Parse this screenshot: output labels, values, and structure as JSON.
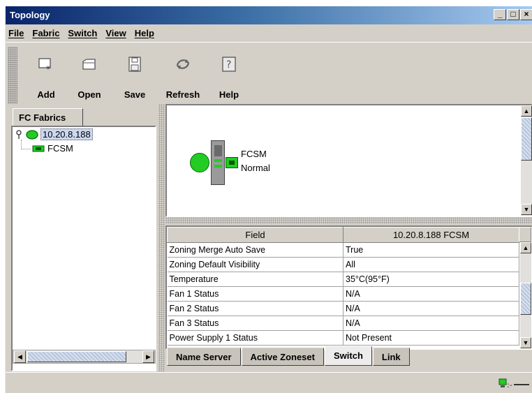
{
  "window": {
    "title": "Topology",
    "minimize": "_",
    "maximize": "□",
    "close": "×"
  },
  "menu": [
    "File",
    "Fabric",
    "Switch",
    "View",
    "Help"
  ],
  "toolbar": [
    {
      "label": "Add",
      "icon": "add-icon"
    },
    {
      "label": "Open",
      "icon": "open-folder-icon"
    },
    {
      "label": "Save",
      "icon": "floppy-disk-icon"
    },
    {
      "label": "Refresh",
      "icon": "refresh-icon"
    },
    {
      "label": "Help",
      "icon": "help-icon"
    }
  ],
  "left_panel": {
    "tab": "FC Fabrics",
    "tree": {
      "fabric": "10.20.8.188",
      "switch": "FCSM"
    }
  },
  "topology": {
    "switch_name": "FCSM",
    "switch_status": "Normal"
  },
  "table": {
    "headers": [
      "Field",
      "10.20.8.188 FCSM"
    ],
    "rows": [
      [
        "Zoning Merge Auto Save",
        "True"
      ],
      [
        "Zoning Default Visibility",
        "All"
      ],
      [
        "Temperature",
        "35°C(95°F)"
      ],
      [
        "Fan 1 Status",
        "N/A"
      ],
      [
        "Fan 2 Status",
        "N/A"
      ],
      [
        "Fan 3 Status",
        "N/A"
      ],
      [
        "Power Supply 1 Status",
        "Not Present"
      ]
    ]
  },
  "bottom_tabs": [
    "Name Server",
    "Active Zoneset",
    "Switch",
    "Link"
  ],
  "active_tab": "Switch",
  "colors": {
    "node_green": "#22cc22",
    "title_blue": "#0a246a",
    "selection": "#ccd8f0"
  }
}
